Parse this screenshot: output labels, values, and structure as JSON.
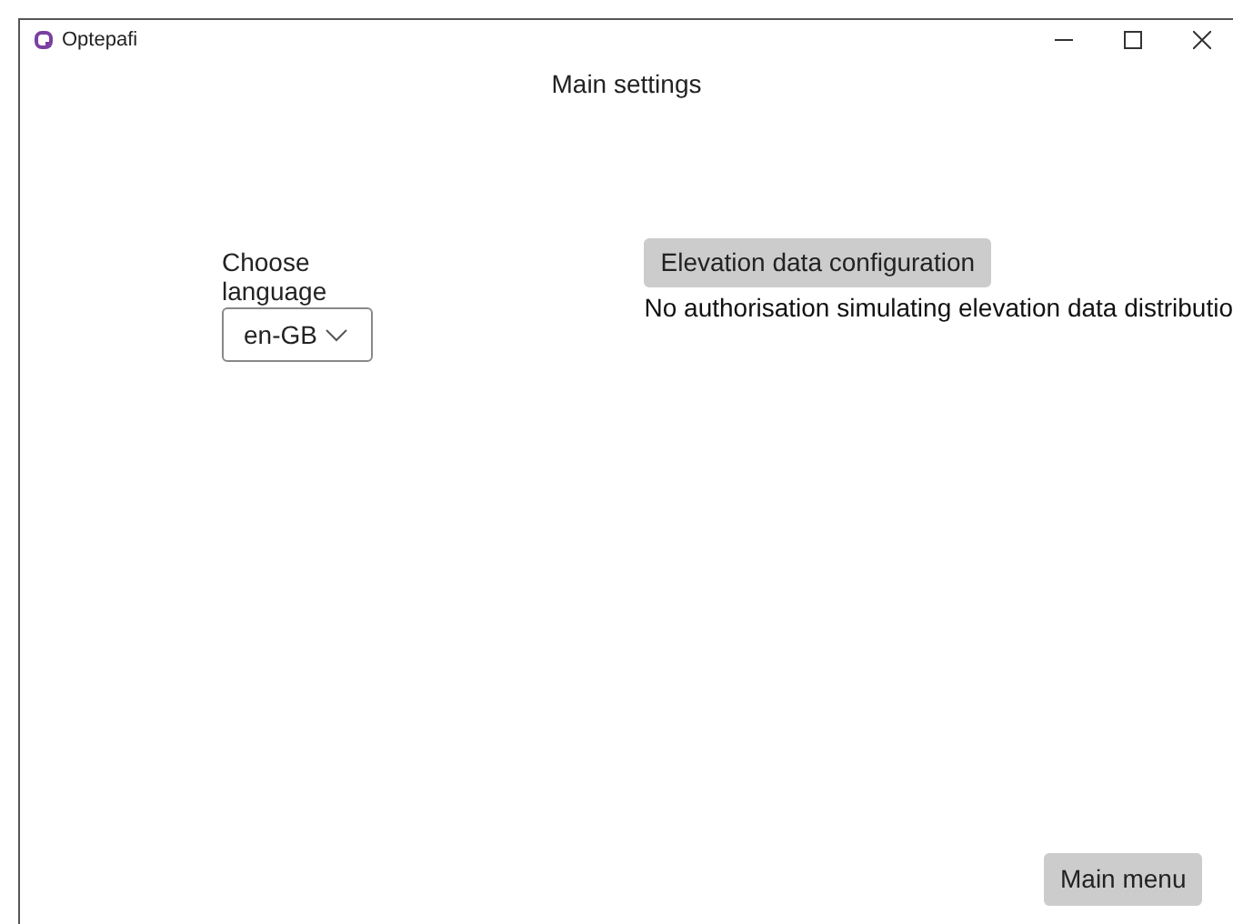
{
  "window": {
    "title": "Optepafi"
  },
  "heading": "Main settings",
  "language": {
    "label": "Choose language",
    "value": "en-GB"
  },
  "elevation": {
    "button": "Elevation data configuration",
    "status": "No authorisation simulating elevation data distributio"
  },
  "footer_button": "Main menu"
}
